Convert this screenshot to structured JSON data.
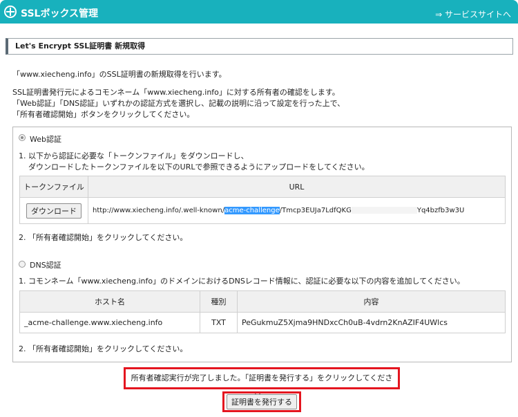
{
  "app": {
    "title": "SSLボックス管理",
    "service_link": "⇒ サービスサイトへ"
  },
  "heading": "Let's Encrypt SSL証明書 新規取得",
  "intro": {
    "domain_line": "「www.xiecheng.info」のSSL証明書の新規取得を行います。",
    "lines": [
      "SSL証明書発行元によるコモンネーム「www.xiecheng.info」に対する所有者の確認をします。",
      "「Web認証」「DNS認証」いずれかの認証方式を選択し、記載の説明に沿って設定を行った上で、",
      "「所有者確認開始」ボタンをクリックしてください。"
    ]
  },
  "web_auth": {
    "label": "Web認証",
    "selected": true,
    "step1_line1": "1. 以下から認証に必要な「トークンファイル」をダウンロードし、",
    "step1_line2": "ダウンロードしたトークンファイルを以下のURLで参照できるようにアップロードをしてください。",
    "col_token": "トークンファイル",
    "col_url": "URL",
    "download_label": "ダウンロード",
    "url_prefix": "http://www.xiecheng.info/.well-known/",
    "url_highlight": "acme-challenge",
    "url_suffix_a": "/Tmcp3EUJa7LdfQKG",
    "url_suffix_b": "Yq4bzfb3w3U",
    "step2": "2. 「所有者確認開始」をクリックしてください。"
  },
  "dns_auth": {
    "label": "DNS認証",
    "selected": false,
    "step1": "1. コモンネーム「www.xiecheng.info」のドメインにおけるDNSレコード情報に、認証に必要な以下の内容を追加してください。",
    "col_host": "ホスト名",
    "col_type": "種別",
    "col_content": "内容",
    "host": "_acme-challenge.www.xiecheng.info",
    "type": "TXT",
    "content": "PeGukmuZ5Xjma9HNDxcCh0uB-4vdrn2KnAZIF4UWlcs",
    "step2": "2. 「所有者確認開始」をクリックしてください。"
  },
  "message": "所有者確認実行が完了しました。「証明書を発行する」をクリックしてください。",
  "issue_button": "証明書を発行する",
  "colors": {
    "header": "#18b1bd",
    "highlight_box": "#e4151f"
  }
}
